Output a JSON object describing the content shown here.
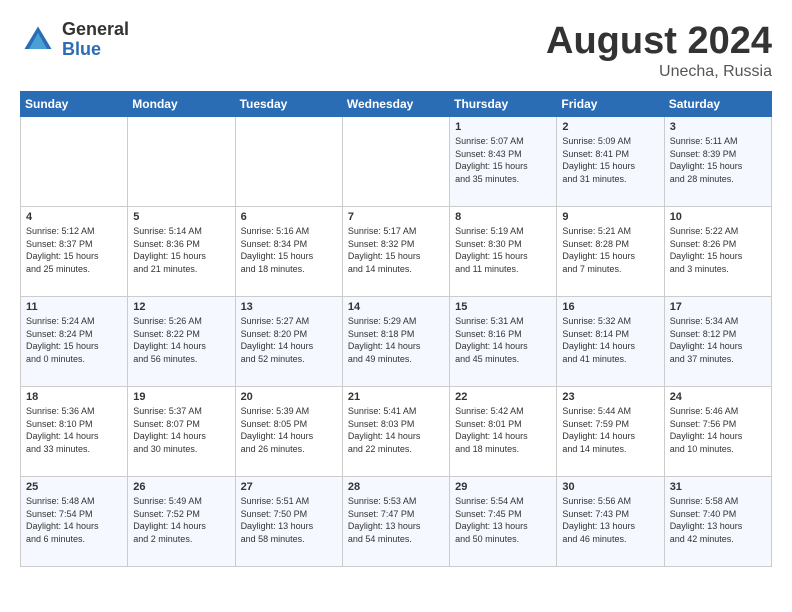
{
  "header": {
    "logo_general": "General",
    "logo_blue": "Blue",
    "title": "August 2024",
    "subtitle": "Unecha, Russia"
  },
  "weekdays": [
    "Sunday",
    "Monday",
    "Tuesday",
    "Wednesday",
    "Thursday",
    "Friday",
    "Saturday"
  ],
  "weeks": [
    [
      {
        "day": "",
        "info": ""
      },
      {
        "day": "",
        "info": ""
      },
      {
        "day": "",
        "info": ""
      },
      {
        "day": "",
        "info": ""
      },
      {
        "day": "1",
        "info": "Sunrise: 5:07 AM\nSunset: 8:43 PM\nDaylight: 15 hours\nand 35 minutes."
      },
      {
        "day": "2",
        "info": "Sunrise: 5:09 AM\nSunset: 8:41 PM\nDaylight: 15 hours\nand 31 minutes."
      },
      {
        "day": "3",
        "info": "Sunrise: 5:11 AM\nSunset: 8:39 PM\nDaylight: 15 hours\nand 28 minutes."
      }
    ],
    [
      {
        "day": "4",
        "info": "Sunrise: 5:12 AM\nSunset: 8:37 PM\nDaylight: 15 hours\nand 25 minutes."
      },
      {
        "day": "5",
        "info": "Sunrise: 5:14 AM\nSunset: 8:36 PM\nDaylight: 15 hours\nand 21 minutes."
      },
      {
        "day": "6",
        "info": "Sunrise: 5:16 AM\nSunset: 8:34 PM\nDaylight: 15 hours\nand 18 minutes."
      },
      {
        "day": "7",
        "info": "Sunrise: 5:17 AM\nSunset: 8:32 PM\nDaylight: 15 hours\nand 14 minutes."
      },
      {
        "day": "8",
        "info": "Sunrise: 5:19 AM\nSunset: 8:30 PM\nDaylight: 15 hours\nand 11 minutes."
      },
      {
        "day": "9",
        "info": "Sunrise: 5:21 AM\nSunset: 8:28 PM\nDaylight: 15 hours\nand 7 minutes."
      },
      {
        "day": "10",
        "info": "Sunrise: 5:22 AM\nSunset: 8:26 PM\nDaylight: 15 hours\nand 3 minutes."
      }
    ],
    [
      {
        "day": "11",
        "info": "Sunrise: 5:24 AM\nSunset: 8:24 PM\nDaylight: 15 hours\nand 0 minutes."
      },
      {
        "day": "12",
        "info": "Sunrise: 5:26 AM\nSunset: 8:22 PM\nDaylight: 14 hours\nand 56 minutes."
      },
      {
        "day": "13",
        "info": "Sunrise: 5:27 AM\nSunset: 8:20 PM\nDaylight: 14 hours\nand 52 minutes."
      },
      {
        "day": "14",
        "info": "Sunrise: 5:29 AM\nSunset: 8:18 PM\nDaylight: 14 hours\nand 49 minutes."
      },
      {
        "day": "15",
        "info": "Sunrise: 5:31 AM\nSunset: 8:16 PM\nDaylight: 14 hours\nand 45 minutes."
      },
      {
        "day": "16",
        "info": "Sunrise: 5:32 AM\nSunset: 8:14 PM\nDaylight: 14 hours\nand 41 minutes."
      },
      {
        "day": "17",
        "info": "Sunrise: 5:34 AM\nSunset: 8:12 PM\nDaylight: 14 hours\nand 37 minutes."
      }
    ],
    [
      {
        "day": "18",
        "info": "Sunrise: 5:36 AM\nSunset: 8:10 PM\nDaylight: 14 hours\nand 33 minutes."
      },
      {
        "day": "19",
        "info": "Sunrise: 5:37 AM\nSunset: 8:07 PM\nDaylight: 14 hours\nand 30 minutes."
      },
      {
        "day": "20",
        "info": "Sunrise: 5:39 AM\nSunset: 8:05 PM\nDaylight: 14 hours\nand 26 minutes."
      },
      {
        "day": "21",
        "info": "Sunrise: 5:41 AM\nSunset: 8:03 PM\nDaylight: 14 hours\nand 22 minutes."
      },
      {
        "day": "22",
        "info": "Sunrise: 5:42 AM\nSunset: 8:01 PM\nDaylight: 14 hours\nand 18 minutes."
      },
      {
        "day": "23",
        "info": "Sunrise: 5:44 AM\nSunset: 7:59 PM\nDaylight: 14 hours\nand 14 minutes."
      },
      {
        "day": "24",
        "info": "Sunrise: 5:46 AM\nSunset: 7:56 PM\nDaylight: 14 hours\nand 10 minutes."
      }
    ],
    [
      {
        "day": "25",
        "info": "Sunrise: 5:48 AM\nSunset: 7:54 PM\nDaylight: 14 hours\nand 6 minutes."
      },
      {
        "day": "26",
        "info": "Sunrise: 5:49 AM\nSunset: 7:52 PM\nDaylight: 14 hours\nand 2 minutes."
      },
      {
        "day": "27",
        "info": "Sunrise: 5:51 AM\nSunset: 7:50 PM\nDaylight: 13 hours\nand 58 minutes."
      },
      {
        "day": "28",
        "info": "Sunrise: 5:53 AM\nSunset: 7:47 PM\nDaylight: 13 hours\nand 54 minutes."
      },
      {
        "day": "29",
        "info": "Sunrise: 5:54 AM\nSunset: 7:45 PM\nDaylight: 13 hours\nand 50 minutes."
      },
      {
        "day": "30",
        "info": "Sunrise: 5:56 AM\nSunset: 7:43 PM\nDaylight: 13 hours\nand 46 minutes."
      },
      {
        "day": "31",
        "info": "Sunrise: 5:58 AM\nSunset: 7:40 PM\nDaylight: 13 hours\nand 42 minutes."
      }
    ]
  ]
}
